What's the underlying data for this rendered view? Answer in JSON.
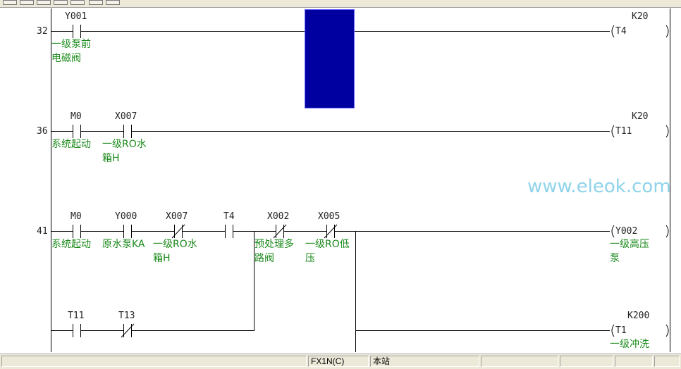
{
  "rungs": [
    {
      "step": "32",
      "contacts": [
        {
          "device": "Y001",
          "type": "NO",
          "comment": [
            "一级泵前",
            "电磁阀"
          ]
        }
      ],
      "coil": {
        "device": "T4",
        "setting": "K20"
      }
    },
    {
      "step": "36",
      "contacts": [
        {
          "device": "M0",
          "type": "NO",
          "comment": [
            "系统起动"
          ]
        },
        {
          "device": "X007",
          "type": "NO",
          "comment": [
            "一级RO水",
            "箱H"
          ]
        }
      ],
      "coil": {
        "device": "T11",
        "setting": "K20"
      }
    },
    {
      "step": "41",
      "contacts": [
        {
          "device": "M0",
          "type": "NO",
          "comment": [
            "系统起动"
          ]
        },
        {
          "device": "Y000",
          "type": "NO",
          "comment": [
            "原水泵KA"
          ]
        },
        {
          "device": "X007",
          "type": "NC",
          "comment": [
            "一级RO水",
            "箱H"
          ]
        },
        {
          "device": "T4",
          "type": "NO",
          "comment": []
        },
        {
          "device": "X002",
          "type": "NC",
          "comment": [
            "预处理多",
            "路阀"
          ]
        },
        {
          "device": "X005",
          "type": "NC",
          "comment": [
            "一级RO低",
            "压"
          ]
        }
      ],
      "coil": {
        "device": "Y002",
        "setting": "",
        "comment": [
          "一级高压",
          "泵"
        ]
      },
      "branch": {
        "contacts": [
          {
            "device": "T11",
            "type": "NO"
          },
          {
            "device": "T13",
            "type": "NC"
          }
        ],
        "coil": {
          "device": "T1",
          "setting": "K200",
          "comment": [
            "一级冲洗"
          ]
        }
      }
    }
  ],
  "watermark": "www.eleok.com",
  "status_bar": {
    "plc_type": "FX1N(C)",
    "station": "本站"
  },
  "colors": {
    "cursor": "#0000a0",
    "comment_text": "#1a8a1a",
    "watermark": "#8fd3ea"
  }
}
